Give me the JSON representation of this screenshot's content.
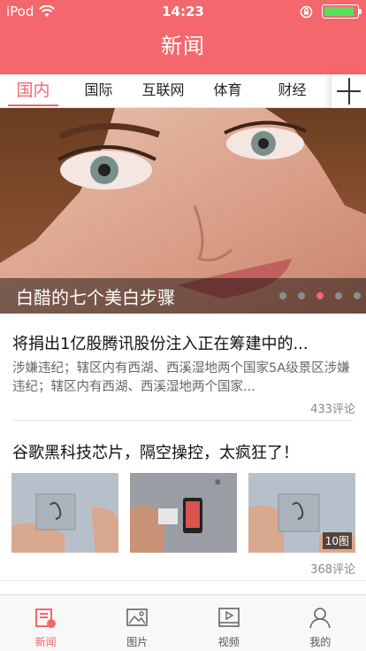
{
  "status_bar": {
    "carrier": "iPod",
    "time": "14:23"
  },
  "nav": {
    "title": "新闻"
  },
  "tabs": [
    {
      "label": "国内",
      "active": true
    },
    {
      "label": "国际",
      "active": false
    },
    {
      "label": "互联网",
      "active": false
    },
    {
      "label": "体育",
      "active": false
    },
    {
      "label": "财经",
      "active": false
    }
  ],
  "carousel": {
    "caption": "白醋的七个美白步骤",
    "dot_count": 5,
    "active_dot": 3
  },
  "articles": [
    {
      "title": "将捐出1亿股腾讯股份注入正在筹建中的...",
      "summary": "涉嫌违纪；辖区内有西湖、西溪湿地两个国家5A级景区涉嫌违纪；辖区内有西湖、西溪湿地两个国家...",
      "comments": "433评论"
    },
    {
      "title": "谷歌黑科技芯片，隔空操控，太疯狂了！",
      "image_count": "10图",
      "comments": "368评论"
    }
  ],
  "tabbar": [
    {
      "label": "新闻",
      "icon": "news-icon",
      "active": true
    },
    {
      "label": "图片",
      "icon": "picture-icon",
      "active": false
    },
    {
      "label": "视频",
      "icon": "video-icon",
      "active": false
    },
    {
      "label": "我的",
      "icon": "profile-icon",
      "active": false
    }
  ],
  "colors": {
    "brand": "#f4676c",
    "battery": "#56e05c"
  }
}
